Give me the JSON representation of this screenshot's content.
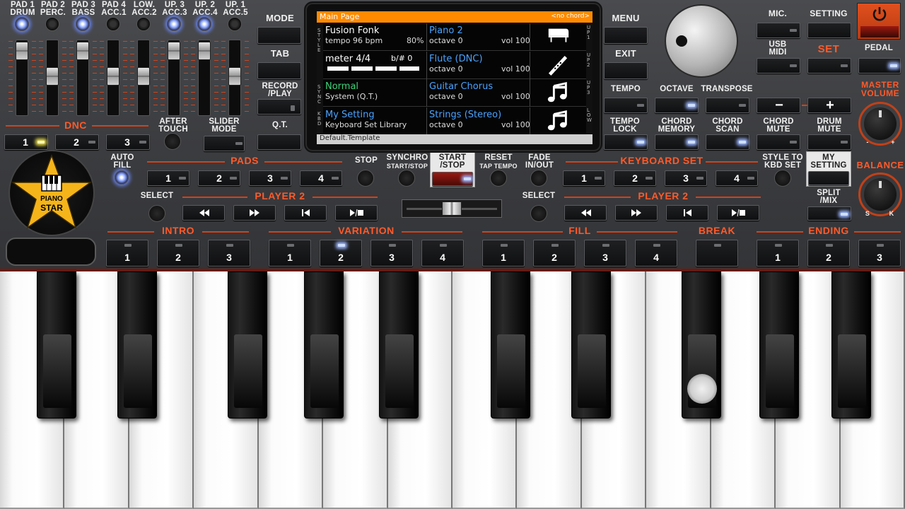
{
  "top_labels": [
    {
      "l1": "PAD 1",
      "l2": "DRUM"
    },
    {
      "l1": "PAD 2",
      "l2": "PERC."
    },
    {
      "l1": "PAD 3",
      "l2": "BASS"
    },
    {
      "l1": "PAD 4",
      "l2": "ACC.1"
    },
    {
      "l1": "LOW.",
      "l2": "ACC.2"
    },
    {
      "l1": "UP. 3",
      "l2": "ACC.3"
    },
    {
      "l1": "UP. 2",
      "l2": "ACC.4"
    },
    {
      "l1": "UP. 1",
      "l2": "ACC.5"
    }
  ],
  "left": {
    "mode": "MODE",
    "tab": "TAB",
    "record_play": "RECORD\n/PLAY",
    "qt": "Q.T.",
    "dnc": "DNC",
    "dnc_buttons": [
      "1",
      "2",
      "3"
    ],
    "after_touch": "AFTER\nTOUCH",
    "slider_mode": "SLIDER\nMODE",
    "auto_fill": "AUTO\nFILL",
    "pads": "PADS",
    "pads_buttons": [
      "1",
      "2",
      "3",
      "4"
    ],
    "select": "SELECT",
    "player2": "PLAYER 2",
    "stop": "STOP",
    "synchro": "SYNCHRO",
    "synchro_sub": "START/STOP",
    "start_stop": "START\n/STOP",
    "reset": "RESET",
    "reset_sub": "TAP TEMPO",
    "fade": "FADE\nIN/OUT",
    "logo_l1": "PIANO",
    "logo_l2": "STAR"
  },
  "display": {
    "title": "Main Page",
    "chord": "<no chord>",
    "side_left": [
      "S T Y L E",
      "S Y N C",
      "K B D"
    ],
    "side_right": [
      "U P 1",
      "U P 2",
      "U P 3",
      "L O W"
    ],
    "rows": [
      {
        "left_name": "Fusion Fonk",
        "left_sub": "tempo 96 bpm",
        "left_pct": "80%",
        "right_name": "Piano 2",
        "right_sub": "octave  0",
        "vol": "vol 100",
        "icon": "grand-piano-icon"
      },
      {
        "left_name": "meter 4/4",
        "left_sub": "b/#  0",
        "right_name": "Flute (DNC)",
        "right_sub": "octave  0",
        "vol": "vol 100",
        "icon": "flute-icon"
      },
      {
        "left_name": "Normal",
        "left_sub": "System (Q.T.)",
        "right_name": "Guitar Chorus",
        "right_sub": "octave  0",
        "vol": "vol 100",
        "icon": "music-note-icon"
      },
      {
        "left_name": "My Setting",
        "left_sub": "Keyboard Set Library",
        "right_name": "Strings (Stereo)",
        "right_sub": "octave  0",
        "vol": "vol 100",
        "icon": "music-note-icon"
      }
    ],
    "footer": "Default.Template"
  },
  "right": {
    "menu": "MENU",
    "exit": "EXIT",
    "mic": "MIC.",
    "setting": "SETTING",
    "usb_midi": "USB\nMIDI",
    "set": "SET",
    "pedal": "PEDAL",
    "tempo": "TEMPO",
    "octave": "OCTAVE",
    "transpose": "TRANSPOSE",
    "minus": "−",
    "plus": "+",
    "master_volume": "MASTER\nVOLUME",
    "balance": "BALANCE",
    "tempo_lock": "TEMPO\nLOCK",
    "chord_memory": "CHORD\nMEMORY",
    "chord_scan": "CHORD\nSCAN",
    "chord_mute": "CHORD\nMUTE",
    "drum_mute": "DRUM\nMUTE",
    "keyboard_set": "KEYBOARD SET",
    "kbd_buttons": [
      "1",
      "2",
      "3",
      "4"
    ],
    "style_to_kbd": "STYLE TO\nKBD SET",
    "my_setting": "MY\nSETTING",
    "select": "SELECT",
    "player2": "PLAYER 2",
    "split_mix": "SPLIT\n/MIX",
    "balance_s": "S",
    "balance_k": "K",
    "vol_minus": "-",
    "vol_plus": "+"
  },
  "bottom": {
    "intro": "INTRO",
    "intro_buttons": [
      "1",
      "2",
      "3"
    ],
    "variation": "VARIATION",
    "variation_buttons": [
      "1",
      "2",
      "3",
      "4"
    ],
    "fill": "FILL",
    "fill_buttons": [
      "1",
      "2",
      "3",
      "4"
    ],
    "break": "BREAK",
    "ending": "ENDING",
    "ending_buttons": [
      "1",
      "2",
      "3"
    ]
  },
  "colors": {
    "accent": "#ff5a2a",
    "display_title": "#ff8a00",
    "display_blue": "#4aa3ff",
    "display_green": "#3ed27a"
  }
}
